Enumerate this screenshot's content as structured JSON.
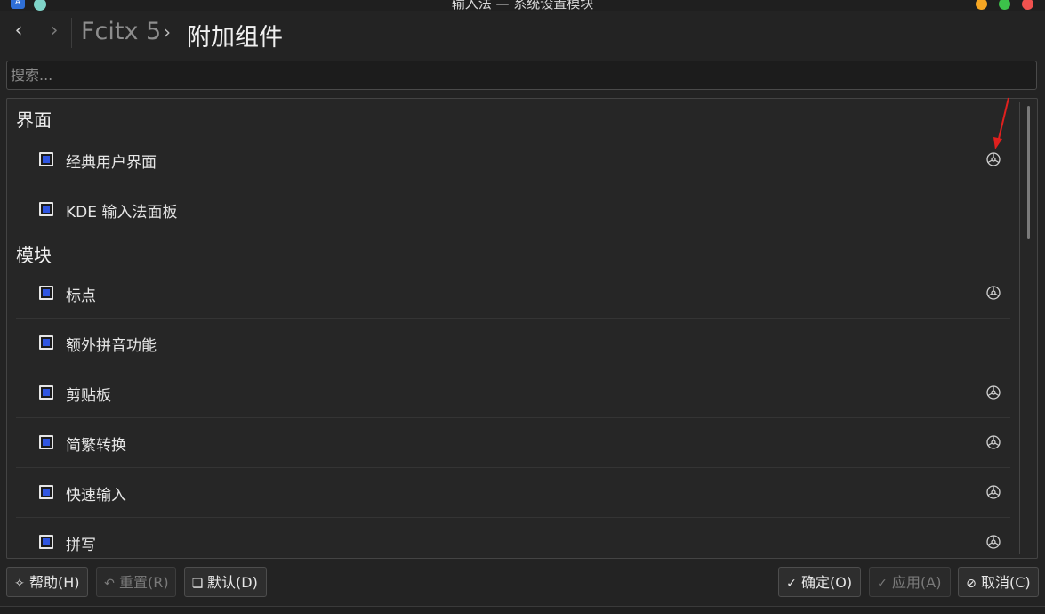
{
  "window": {
    "title": "输入法 — 系统设置模块",
    "app_badge": "A"
  },
  "nav": {
    "back_icon": "‹",
    "forward_icon": "›",
    "breadcrumb_parent": "Fcitx 5",
    "breadcrumb_separator": "›",
    "breadcrumb_current": "附加组件"
  },
  "search": {
    "placeholder": "搜索...",
    "value": ""
  },
  "sections": [
    {
      "title": "界面",
      "items": [
        {
          "label": "经典用户界面",
          "checked": true,
          "configurable": true
        },
        {
          "label": "KDE 输入法面板",
          "checked": true,
          "configurable": false
        }
      ]
    },
    {
      "title": "模块",
      "items": [
        {
          "label": "标点",
          "checked": true,
          "configurable": true
        },
        {
          "label": "额外拼音功能",
          "checked": true,
          "configurable": false
        },
        {
          "label": "剪贴板",
          "checked": true,
          "configurable": true
        },
        {
          "label": "简繁转换",
          "checked": true,
          "configurable": true
        },
        {
          "label": "快速输入",
          "checked": true,
          "configurable": true
        },
        {
          "label": "拼写",
          "checked": true,
          "configurable": true
        }
      ]
    }
  ],
  "buttons": {
    "help": "帮助(H)",
    "reset": "重置(R)",
    "default": "默认(D)",
    "ok": "确定(O)",
    "apply": "应用(A)",
    "cancel": "取消(C)"
  },
  "colors": {
    "accent": "#2f55e0",
    "annotation_arrow": "#e0201e"
  }
}
